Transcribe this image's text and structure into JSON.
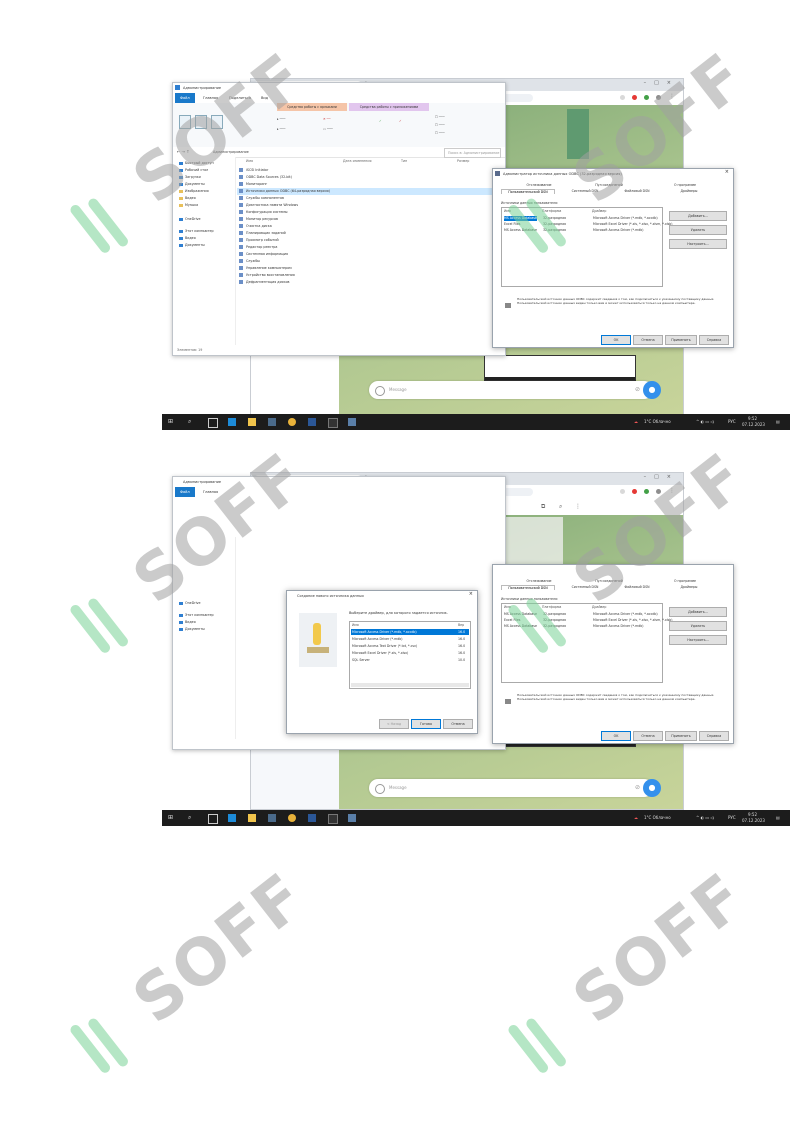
{
  "watermark": "SOFF",
  "colors": {
    "accent": "#0078d7",
    "telegram_blue": "#3390ec",
    "watermark_green": "#78d296",
    "taskbar": "#1c1c1c"
  },
  "shot1": {
    "browser": {
      "tab_title": "Telegram Web",
      "url": "web.telegram.org/k/#-"
    },
    "explorer": {
      "title": "Администрирование",
      "ribbon_tabs": [
        "Файл",
        "Главная",
        "Поделиться",
        "Вид"
      ],
      "context_tabs": [
        "Средства работы с ярлыками",
        "Средства работы с приложениями"
      ],
      "search_placeholder": "Поиск в: Администрирование",
      "nav_items": [
        "Быстрый доступ",
        "Рабочий стол",
        "Загрузки",
        "Документы",
        "Изображения",
        "Видео",
        "Музыка",
        "OneDrive",
        "Этот компьютер",
        "Видео",
        "Документы"
      ],
      "col_headers": [
        "Имя",
        "Дата изменения",
        "Тип",
        "Размер"
      ],
      "files": [
        "iSCSI Initiator",
        "ODBC Data Sources (32-bit)",
        "Мониторинг",
        "Источники данных ODBC (64-разрядная версия)",
        "Службы компонентов",
        "Диагностика памяти Windows",
        "Конфигурация системы",
        "Монитор ресурсов",
        "Очистка диска",
        "Планировщик заданий",
        "Просмотр событий",
        "Редактор реестра",
        "Системная информация",
        "Службы",
        "Управление компьютером",
        "Устройство восстановления",
        "Дефрагментация дисков"
      ],
      "status": "Элементов: 19"
    },
    "odbc": {
      "title": "Администратор источника данных ODBC (32-разрядная версия)",
      "tabs_top": [
        "Отслеживание",
        "Пул соединений",
        "О программе"
      ],
      "tabs_bottom": [
        "Пользовательский DSN",
        "Системный DSN",
        "Файловый DSN",
        "Драйверы"
      ],
      "group_label": "Источники данных пользователя:",
      "col_headers": [
        "Имя",
        "Платформа",
        "Драйвер"
      ],
      "rows": [
        [
          "MS Access Database",
          "32-разрядная",
          "Microsoft Access Driver (*.mdb, *.accdb)"
        ],
        [
          "Excel Files",
          "32-разрядная",
          "Microsoft Excel Driver (*.xls, *.xlsx, *.xlsm, *.xlsb)"
        ],
        [
          "MS Access Database",
          "32-разрядная",
          "Microsoft Access Driver (*.mdb)"
        ]
      ],
      "side_buttons": [
        "Добавить...",
        "Удалить",
        "Настроить..."
      ],
      "info_text": "Пользовательский источник данных ODBC содержит сведения о том, как подключиться к указанному поставщику данных. Пользовательский источник данных виден только вам и может использоваться только на данном компьютере.",
      "bottom_buttons": [
        "OK",
        "Отмена",
        "Применить",
        "Справка"
      ]
    },
    "telegram": {
      "message_placeholder": "Message"
    },
    "taskbar": {
      "weather": "1°C Облачно",
      "lang": "РУС",
      "time": "9:52",
      "date": "07.12.2023"
    }
  },
  "shot2": {
    "browser": {
      "tab_title": "Telegram Web",
      "url": "web.telegram.org/k/#-"
    },
    "telegram": {
      "chat_title": "Saved Messages",
      "pinned_label": "Pinned Message",
      "message_placeholder": "Message"
    },
    "create_dialog": {
      "title": "Создание нового источника данных",
      "prompt": "Выберите драйвер, для которого задается источник.",
      "col_headers": [
        "Имя",
        "Вер"
      ],
      "drivers": [
        "Microsoft Access Driver (*.mdb, *.accdb)",
        "Microsoft Access Driver (*.mdb)",
        "Microsoft Access Text Driver (*.txt, *.csv)",
        "Microsoft Excel Driver (*.xls, *.xlsx)",
        "SQL Server"
      ],
      "versions": [
        "16.0",
        "16.0",
        "16.0",
        "16.0",
        "10.0"
      ],
      "buttons": [
        "< Назад",
        "Готово",
        "Отмена"
      ]
    },
    "odbc": {
      "tabs_top": [
        "Отслеживание",
        "Пул соединений",
        "О программе"
      ],
      "tabs_bottom": [
        "Пользовательский DSN",
        "Системный DSN",
        "Файловый DSN",
        "Драйверы"
      ],
      "group_label": "Источники данных пользователя:",
      "col_headers": [
        "Имя",
        "Платформа",
        "Драйвер"
      ],
      "rows": [
        [
          "MS Access Database",
          "32-разрядная",
          "Microsoft Access Driver (*.mdb, *.accdb)"
        ],
        [
          "Excel Files",
          "32-разрядная",
          "Microsoft Excel Driver (*.xls, *.xlsx, *.xlsm, *.xlsb)"
        ],
        [
          "MS Access Database",
          "32-разрядная",
          "Microsoft Access Driver (*.mdb)"
        ]
      ],
      "side_buttons": [
        "Добавить...",
        "Удалить",
        "Настроить..."
      ],
      "info_text": "Пользовательский источник данных ODBC содержит сведения о том, как подключиться к указанному поставщику данных. Пользовательский источник данных виден только вам и может использоваться только на данном компьютере.",
      "bottom_buttons": [
        "OK",
        "Отмена",
        "Применить",
        "Справка"
      ]
    },
    "taskbar": {
      "weather": "1°C Облачно",
      "lang": "РУС",
      "time": "9:52",
      "date": "07.12.2023"
    }
  }
}
